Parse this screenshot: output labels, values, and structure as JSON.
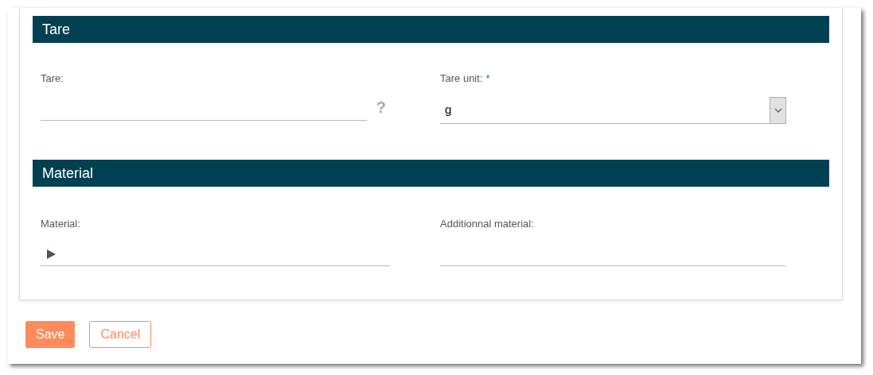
{
  "sections": [
    {
      "title": "Tare",
      "fields": [
        {
          "kind": "text",
          "label": "Tare:",
          "help": "?"
        },
        {
          "kind": "select",
          "label": "Tare unit:",
          "value": "g",
          "required_mark": "*"
        }
      ]
    },
    {
      "title": "Material",
      "fields": [
        {
          "kind": "tree",
          "label": "Material:",
          "expanded": false
        },
        {
          "kind": "text",
          "label": "Additionnal material:"
        }
      ]
    }
  ],
  "buttons": [
    {
      "kind": "primary",
      "label": "Save"
    },
    {
      "kind": "secondary",
      "label": "Cancel"
    }
  ]
}
